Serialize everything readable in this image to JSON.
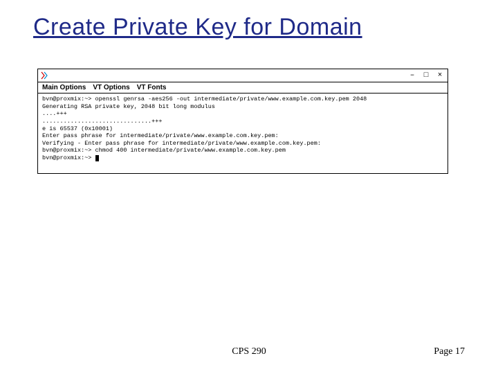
{
  "title": "Create Private Key for Domain",
  "window": {
    "minimize_glyph": "–",
    "maximize_glyph": "□",
    "close_glyph": "×"
  },
  "menubar": {
    "m1": "Main Options",
    "m2": "VT Options",
    "m3": "VT Fonts"
  },
  "terminal": {
    "l1": "bvn@proxmix:~> openssl genrsa -aes256 -out intermediate/private/www.example.com.key.pem 2048",
    "l2": "Generating RSA private key, 2048 bit long modulus",
    "l3": "....+++",
    "l4": "...............................+++",
    "l5": "e is 65537 (0x10001)",
    "l6": "Enter pass phrase for intermediate/private/www.example.com.key.pem:",
    "l7": "Verifying - Enter pass phrase for intermediate/private/www.example.com.key.pem:",
    "l8": "bvn@proxmix:~> chmod 400 intermediate/private/www.example.com.key.pem",
    "l9": "bvn@proxmix:~> "
  },
  "footer": {
    "course": "CPS 290",
    "page": "Page 17"
  }
}
